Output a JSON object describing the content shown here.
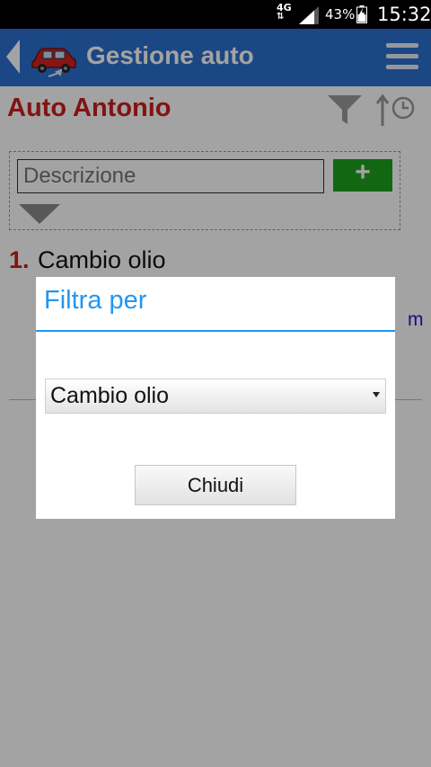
{
  "status_bar": {
    "network": "4G",
    "network_arrows": "⇅",
    "battery_percent": "43%",
    "time": "15:32"
  },
  "action_bar": {
    "title": "Gestione auto",
    "icons": [
      "back-arrow-icon",
      "car-logo-icon",
      "menu-icon"
    ]
  },
  "page": {
    "title": "Auto Antonio",
    "icons": [
      "filter-icon",
      "sort-time-icon"
    ]
  },
  "add_form": {
    "description_placeholder": "Descrizione",
    "add_label": "+"
  },
  "list": [
    {
      "number": "1.",
      "text": "Cambio olio",
      "km_fragment": "m"
    }
  ],
  "dialog": {
    "title": "Filtra per",
    "selected_option": "Cambio olio",
    "close_label": "Chiudi"
  },
  "colors": {
    "action_bar": "#2b6fcf",
    "title_red": "#cc1f1f",
    "dialog_accent": "#2196f3",
    "add_green": "#1fa21f"
  }
}
